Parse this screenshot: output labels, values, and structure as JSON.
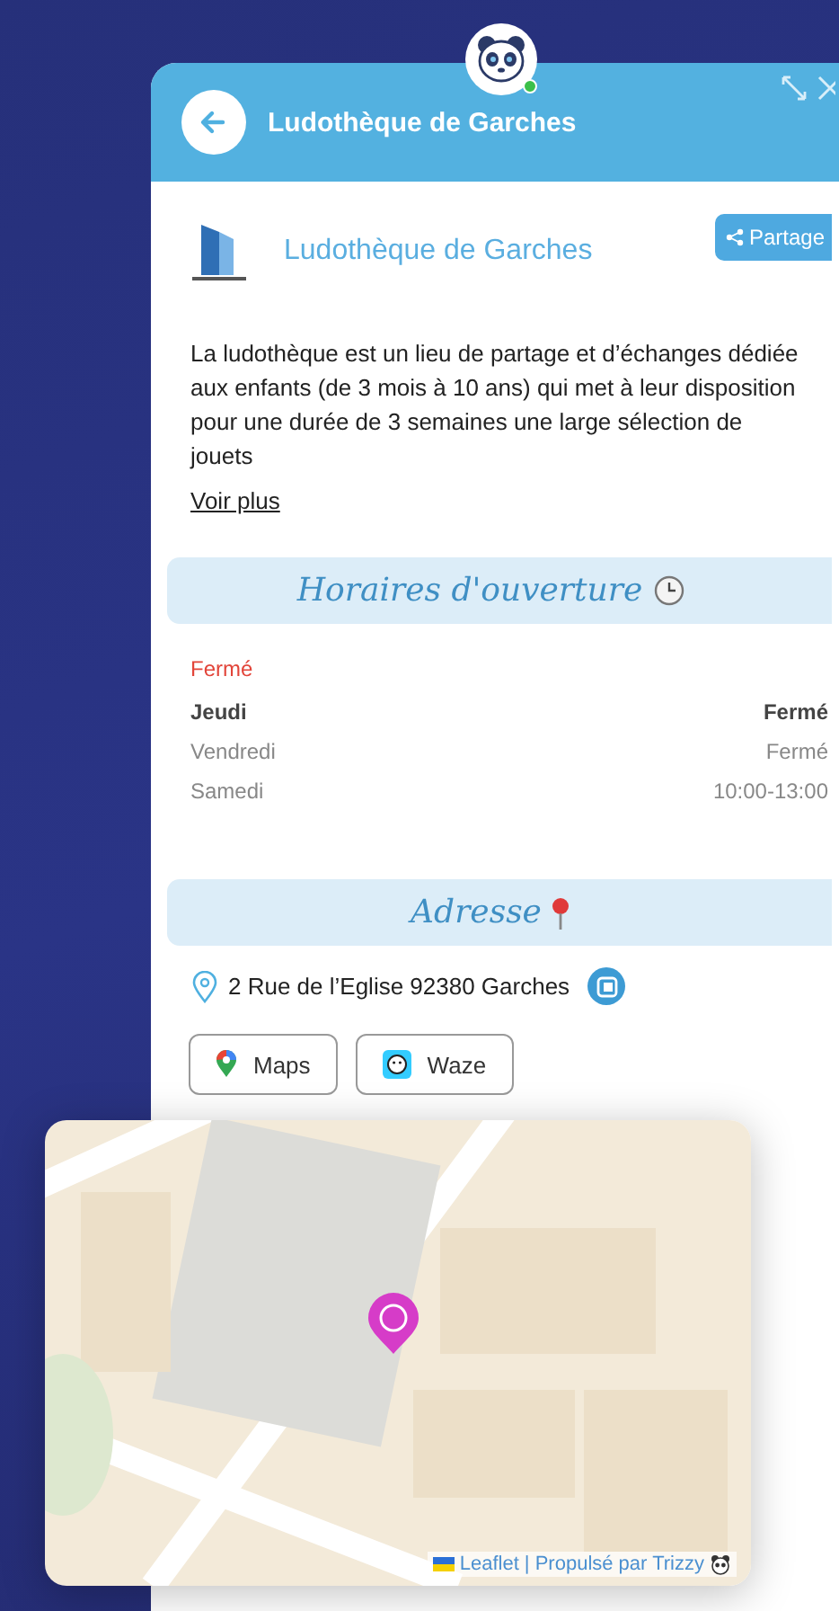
{
  "header": {
    "title": "Ludothèque de Garches"
  },
  "place": {
    "name": "Ludothèque de Garches",
    "share_label": "Partage"
  },
  "description": "La ludothèque est un lieu de partage et d’échanges dédiée aux enfants (de 3 mois à 10 ans) qui met à leur disposition pour une durée de 3 semaines une large sélection de jouets",
  "more_link": "Voir plus",
  "hours": {
    "title": "Horaires d'ouverture",
    "status": "Fermé",
    "rows": [
      {
        "day": "Jeudi",
        "time": "Fermé",
        "today": true
      },
      {
        "day": "Vendredi",
        "time": "Fermé",
        "today": false
      },
      {
        "day": "Samedi",
        "time": "10:00-13:00",
        "today": false
      }
    ]
  },
  "address": {
    "title": "Adresse",
    "line": "2 Rue de l’Eglise 92380 Garches",
    "buttons": [
      {
        "kind": "maps",
        "label": "Maps"
      },
      {
        "kind": "waze",
        "label": "Waze"
      }
    ]
  },
  "map": {
    "attribution": "Leaflet | Propulsé par Trizzy"
  }
}
